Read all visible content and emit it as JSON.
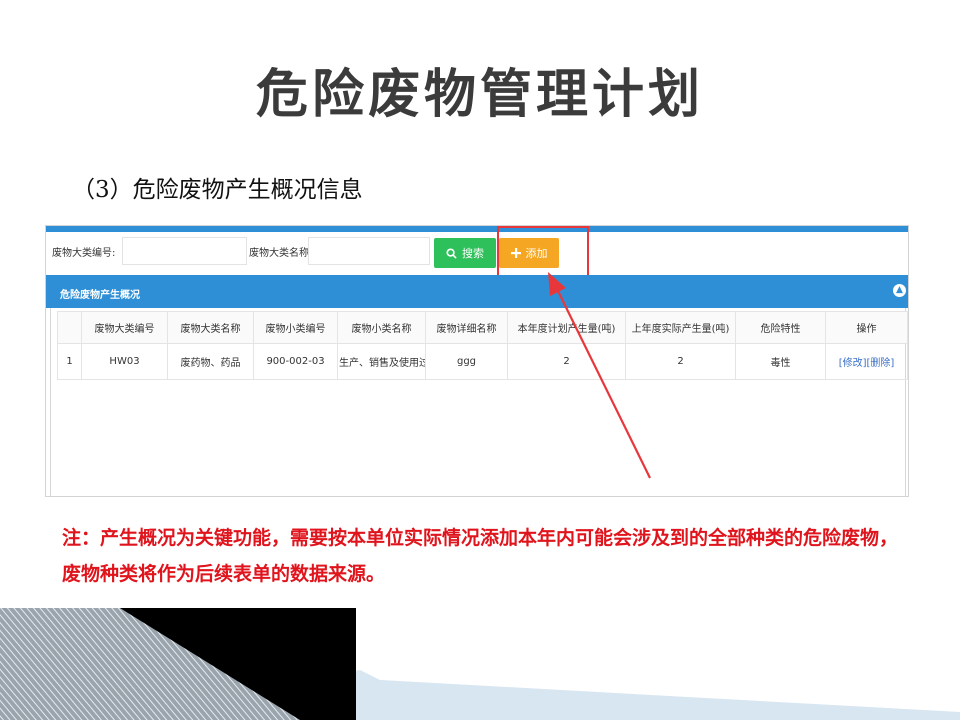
{
  "slide": {
    "title": "危险废物管理计划",
    "section_heading": "（3）危险废物产生概况信息",
    "note": "注：产生概况为关键功能，需要按本单位实际情况添加本年内可能会涉及到的全部种类的危险废物，废物种类将作为后续表单的数据来源。"
  },
  "search": {
    "category_code_label": "废物大类编号:",
    "category_code_value": "",
    "category_name_label": "废物大类名称:",
    "category_name_value": "",
    "search_button": "搜索",
    "add_button": "添加"
  },
  "panel": {
    "title": "危险废物产生概况"
  },
  "table": {
    "headers": [
      "",
      "废物大类编号",
      "废物大类名称",
      "废物小类编号",
      "废物小类名称",
      "废物详细名称",
      "本年度计划产生量(吨)",
      "上年度实际产生量(吨)",
      "危险特性",
      "操作"
    ],
    "rows": [
      {
        "index": "1",
        "category_code": "HW03",
        "category_name": "废药物、药品",
        "subcategory_code": "900-002-03",
        "subcategory_name": "生产、销售及使用过",
        "detail_name": "ggg",
        "planned": "2",
        "actual": "2",
        "hazard": "毒性",
        "edit": "[修改]",
        "delete": "[删除]"
      }
    ]
  },
  "colors": {
    "panel_blue": "#2f8fd6",
    "search_green": "#2ec05a",
    "add_orange": "#f5a623",
    "annotation_red": "#e8373b",
    "note_red": "#e0141c"
  }
}
